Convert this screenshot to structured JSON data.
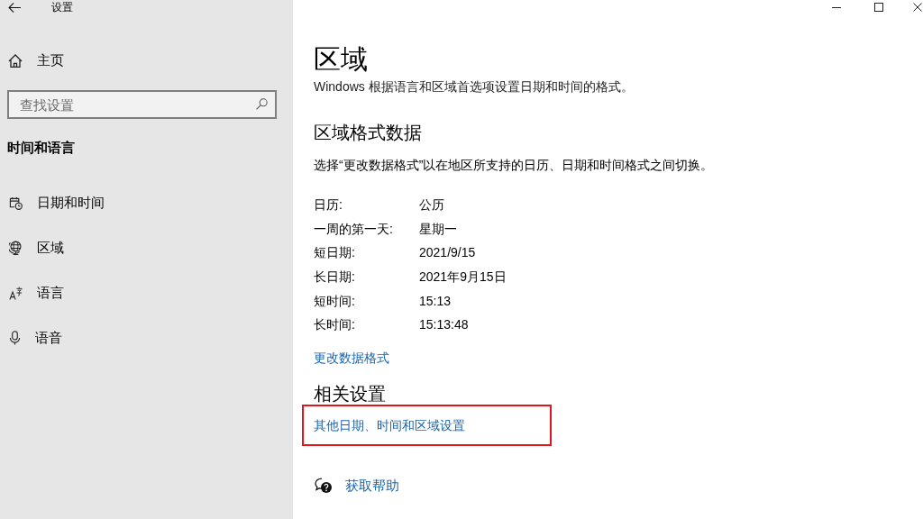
{
  "window": {
    "title": "设置"
  },
  "sidebar": {
    "home": {
      "label": "主页"
    },
    "search": {
      "placeholder": "查找设置"
    },
    "section": "时间和语言",
    "items": [
      {
        "label": "日期和时间",
        "selected": false
      },
      {
        "label": "区域",
        "selected": false
      },
      {
        "label": "语言",
        "selected": false
      },
      {
        "label": "语音",
        "selected": false
      }
    ]
  },
  "page": {
    "title": "区域",
    "subtitle": "Windows 根据语言和区域首选项设置日期和时间的格式。",
    "sections": [
      {
        "heading": "区域格式数据",
        "description": "选择“更改数据格式”以在地区所支持的日历、日期和时间格式之间切换。",
        "rows": [
          {
            "label": "日历:",
            "value": "公历"
          },
          {
            "label": "一周的第一天:",
            "value": "星期一"
          },
          {
            "label": "短日期:",
            "value": "2021/9/15"
          },
          {
            "label": "长日期:",
            "value": "2021年9月15日"
          },
          {
            "label": "短时间:",
            "value": "15:13"
          },
          {
            "label": "长时间:",
            "value": "15:13:48"
          }
        ],
        "link": "更改数据格式"
      }
    ],
    "related": {
      "heading": "相关设置",
      "links": [
        {
          "label": "其他日期、时间和区域设置",
          "highlighted": true
        }
      ]
    },
    "help": {
      "label": "获取帮助"
    }
  }
}
